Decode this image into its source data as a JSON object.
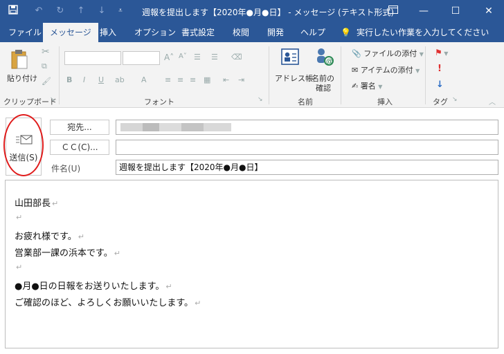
{
  "title": "週報を提出します【2020年●月●日】 - メッセージ (テキスト形式)",
  "tabs": [
    "ファイル",
    "メッセージ",
    "挿入",
    "オプション",
    "書式設定",
    "校閲",
    "開発",
    "ヘルプ"
  ],
  "tell_me": "実行したい作業を入力してください",
  "ribbon": {
    "paste": "貼り付け",
    "clipboard": "クリップボード",
    "font": "フォント",
    "address_book": "アドレス帳",
    "check_names_1": "名前の",
    "check_names_2": "確認",
    "names": "名前",
    "attach_file": "ファイルの添付",
    "attach_item": "アイテムの添付",
    "signature": "署名",
    "insert": "挿入",
    "tags": "タグ"
  },
  "form": {
    "send": "送信(S)",
    "to_button": "宛先...",
    "cc_button": "ＣＣ(C)...",
    "subject_label": "件名(U)",
    "subject_value": "週報を提出します【2020年●月●日】"
  },
  "body_lines": [
    "山田部長",
    "",
    "お疲れ様です。",
    "営業部一課の浜本です。",
    "",
    "●月●日の日報をお送りいたします。",
    "ご確認のほど、よろしくお願いいたします。"
  ],
  "return_mark": "↵"
}
